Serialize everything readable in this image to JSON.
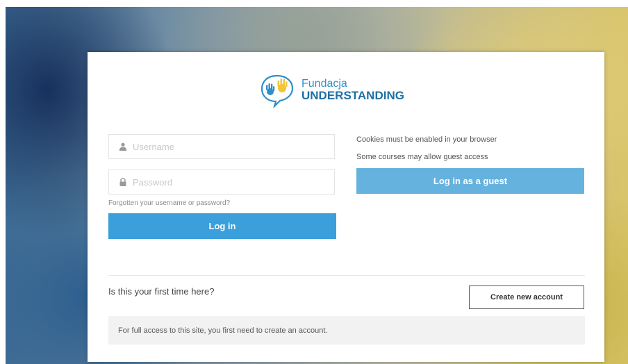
{
  "brand": {
    "name_line1": "Fundacja",
    "name_line2": "UNDERSTANDING",
    "colors": {
      "blue": "#2f8fc9",
      "dark_blue": "#1f6fa5",
      "yellow": "#f3c43a"
    }
  },
  "login": {
    "username_placeholder": "Username",
    "password_placeholder": "Password",
    "username_icon": "user-icon",
    "password_icon": "lock-icon",
    "forgot_link": "Forgotten your username or password?",
    "login_button": "Log in"
  },
  "guest": {
    "cookies_note": "Cookies must be enabled in your browser",
    "guest_note": "Some courses may allow guest access",
    "guest_button": "Log in as a guest"
  },
  "signup": {
    "first_time": "Is this your first time here?",
    "create_button": "Create new account",
    "notice": "For full access to this site, you first need to create an account."
  },
  "colors": {
    "primary_button": "#3a9fdb",
    "guest_button": "#66b2de",
    "notice_bg": "#f2f2f2"
  }
}
